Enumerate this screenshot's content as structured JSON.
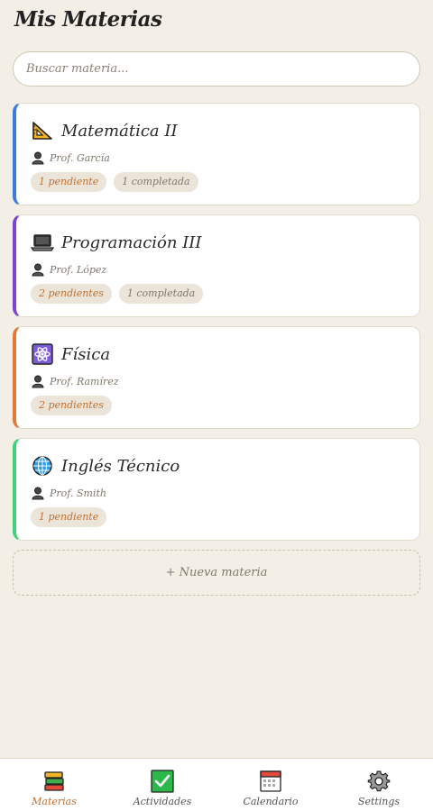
{
  "header": {
    "title": "Mis Materias"
  },
  "search": {
    "placeholder": "Buscar materia..."
  },
  "subjects": [
    {
      "name": "Matemática II",
      "icon": "triangle-ruler-icon",
      "professor": "Prof. García",
      "accent": "#3b7dd8",
      "badges": [
        {
          "label": "1 pendiente",
          "kind": "pending"
        },
        {
          "label": "1 completada",
          "kind": "done"
        }
      ]
    },
    {
      "name": "Programación III",
      "icon": "laptop-icon",
      "professor": "Prof. López",
      "accent": "#7e43d6",
      "badges": [
        {
          "label": "2 pendientes",
          "kind": "pending"
        },
        {
          "label": "1 completada",
          "kind": "done"
        }
      ]
    },
    {
      "name": "Física",
      "icon": "atom-icon",
      "professor": "Prof. Ramírez",
      "accent": "#e07b39",
      "badges": [
        {
          "label": "2 pendientes",
          "kind": "pending"
        }
      ]
    },
    {
      "name": "Inglés Técnico",
      "icon": "globe-icon",
      "professor": "Prof. Smith",
      "accent": "#3fd27a",
      "badges": [
        {
          "label": "1 pendiente",
          "kind": "pending"
        }
      ]
    }
  ],
  "new_subject": {
    "label": "+ Nueva materia"
  },
  "nav": [
    {
      "label": "Materias",
      "icon": "books-icon",
      "active": true
    },
    {
      "label": "Actividades",
      "icon": "checkbox-icon",
      "active": false
    },
    {
      "label": "Calendario",
      "icon": "calendar-icon",
      "active": false
    },
    {
      "label": "Settings",
      "icon": "gear-icon",
      "active": false
    }
  ],
  "colors": {
    "accent_active": "#c07030",
    "background": "#f4efe6"
  }
}
